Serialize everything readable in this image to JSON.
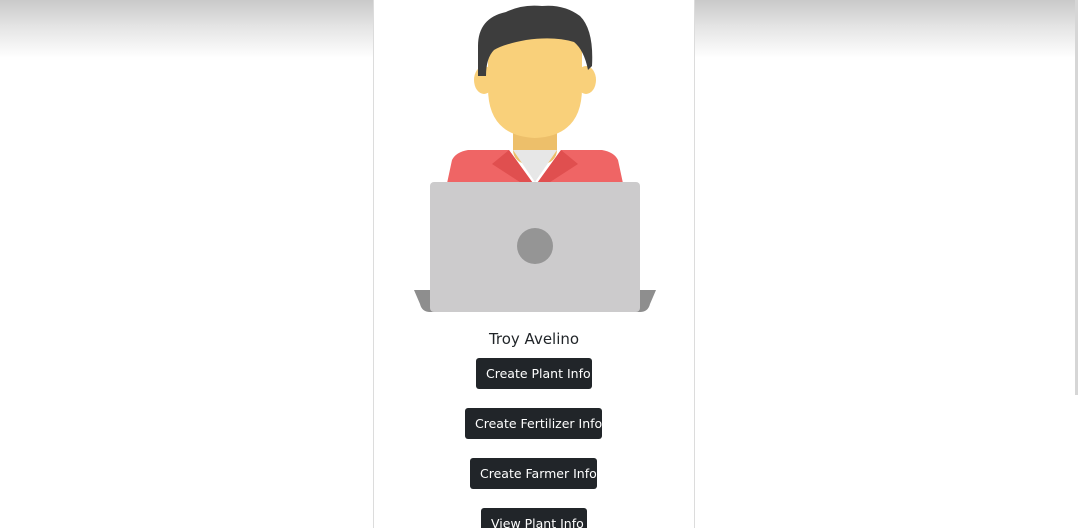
{
  "profile": {
    "name": "Troy Avelino",
    "avatar_icon": "developer-avatar-icon"
  },
  "actions": {
    "create_plant": "Create Plant Info",
    "create_fertilizer": "Create Fertilizer Info",
    "create_farmer": "Create Farmer Info",
    "view_plant": "View Plant Info"
  },
  "colors": {
    "button_bg": "#212529",
    "button_text": "#ffffff",
    "skin": "#f9d07a",
    "hair": "#3d3d3d",
    "jacket": "#ef6565",
    "laptop": "#cccbcc"
  }
}
